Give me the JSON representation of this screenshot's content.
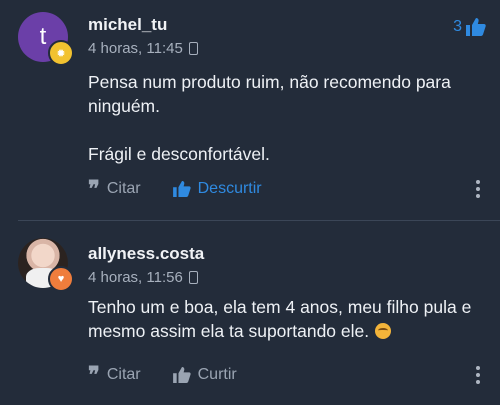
{
  "comments": [
    {
      "avatar_letter": "t",
      "username": "michel_tu",
      "time": "4 horas, 11:45",
      "like_count": "3",
      "paragraphs": [
        "Pensa num produto ruim, não recomendo para ninguém.",
        "Frágil e desconfortável."
      ],
      "quote_label": "Citar",
      "like_label": "Descurtir"
    },
    {
      "username": "allyness.costa",
      "time": "4 horas, 11:56",
      "paragraphs": [
        "Tenho um e boa, ela tem 4 anos, meu filho pula e mesmo assim ela ta suportando ele."
      ],
      "quote_label": "Citar",
      "like_label": "Curtir"
    }
  ],
  "colors": {
    "background": "#232c3a",
    "accent_blue": "#2f8ae0",
    "muted": "#9aa4b2"
  },
  "icons": {
    "quote": "quote-icon",
    "thumb": "thumbs-up-icon",
    "more": "more-vertical-icon",
    "device": "mobile-phone-icon"
  }
}
